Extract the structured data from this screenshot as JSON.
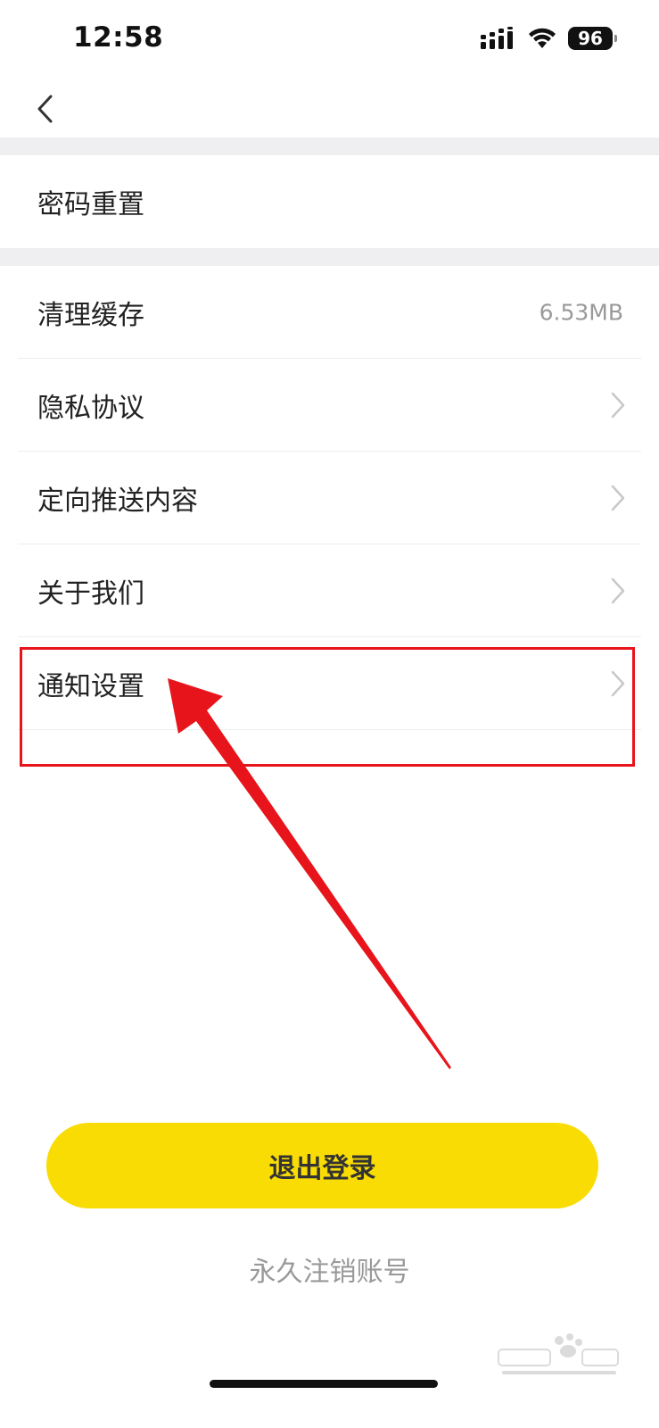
{
  "status_bar": {
    "time": "12:58",
    "battery": "96"
  },
  "nav": {
    "back_icon": "chevron-left-icon"
  },
  "settings": {
    "password_reset": "密码重置",
    "clear_cache": {
      "label": "清理缓存",
      "value": "6.53MB"
    },
    "privacy_policy": "隐私协议",
    "targeted_push": "定向推送内容",
    "about_us": "关于我们",
    "notification_settings": "通知设置"
  },
  "actions": {
    "logout": "退出登录",
    "deactivate": "永久注销账号"
  },
  "annotation": {
    "highlight_color": "#e8141b"
  },
  "watermark": {
    "logo": "Baidu 经验",
    "site": "jingyan.baidu.com"
  },
  "colors": {
    "accent": "#f9dc04",
    "section_gap": "#efeff1",
    "secondary_text": "#999999"
  }
}
